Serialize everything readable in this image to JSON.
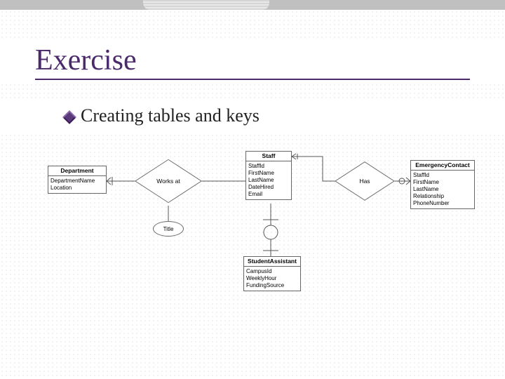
{
  "slide": {
    "title": "Exercise",
    "bullet": "Creating tables and keys"
  },
  "diagram": {
    "entities": {
      "department": {
        "name": "Department",
        "attrs": [
          "DepartmentName",
          "Location"
        ]
      },
      "staff": {
        "name": "Staff",
        "attrs": [
          "StaffId",
          "FirstName",
          "LastName",
          "DateHired",
          "Email"
        ]
      },
      "emergency": {
        "name": "EmergencyContact",
        "attrs": [
          "StaffId",
          "FirstName",
          "LastName",
          "Relationship",
          "PhoneNumber"
        ]
      },
      "student_assistant": {
        "name": "StudentAssistant",
        "attrs": [
          "CampusId",
          "WeeklyHour",
          "FundingSource"
        ]
      }
    },
    "relationships": {
      "works_at": "Works at",
      "has": "Has"
    },
    "attributes": {
      "title": "Title"
    }
  }
}
